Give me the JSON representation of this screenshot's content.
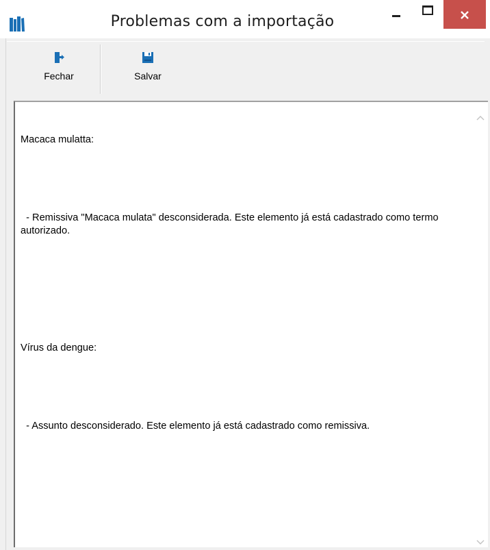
{
  "window": {
    "title": "Problemas com a importação",
    "icon": "books-icon",
    "controls": [
      "minimize-icon",
      "maximize-icon",
      "close-icon"
    ],
    "close_color": "#c7504b"
  },
  "toolbar": {
    "close_label": "Fechar",
    "close_icon": "exit-door-icon",
    "save_label": "Salvar",
    "save_icon": "floppy-disk-icon",
    "icon_color": "#1a6fb5"
  },
  "log": {
    "lines": [
      "Macaca mulatta:",
      "",
      "  - Remissiva \"Macaca mulata\" desconsiderada. Este elemento já está cadastrado como termo autorizado.",
      "",
      "",
      "Vírus da dengue:",
      "",
      "  - Assunto desconsiderado. Este elemento já está cadastrado como remissiva."
    ]
  }
}
